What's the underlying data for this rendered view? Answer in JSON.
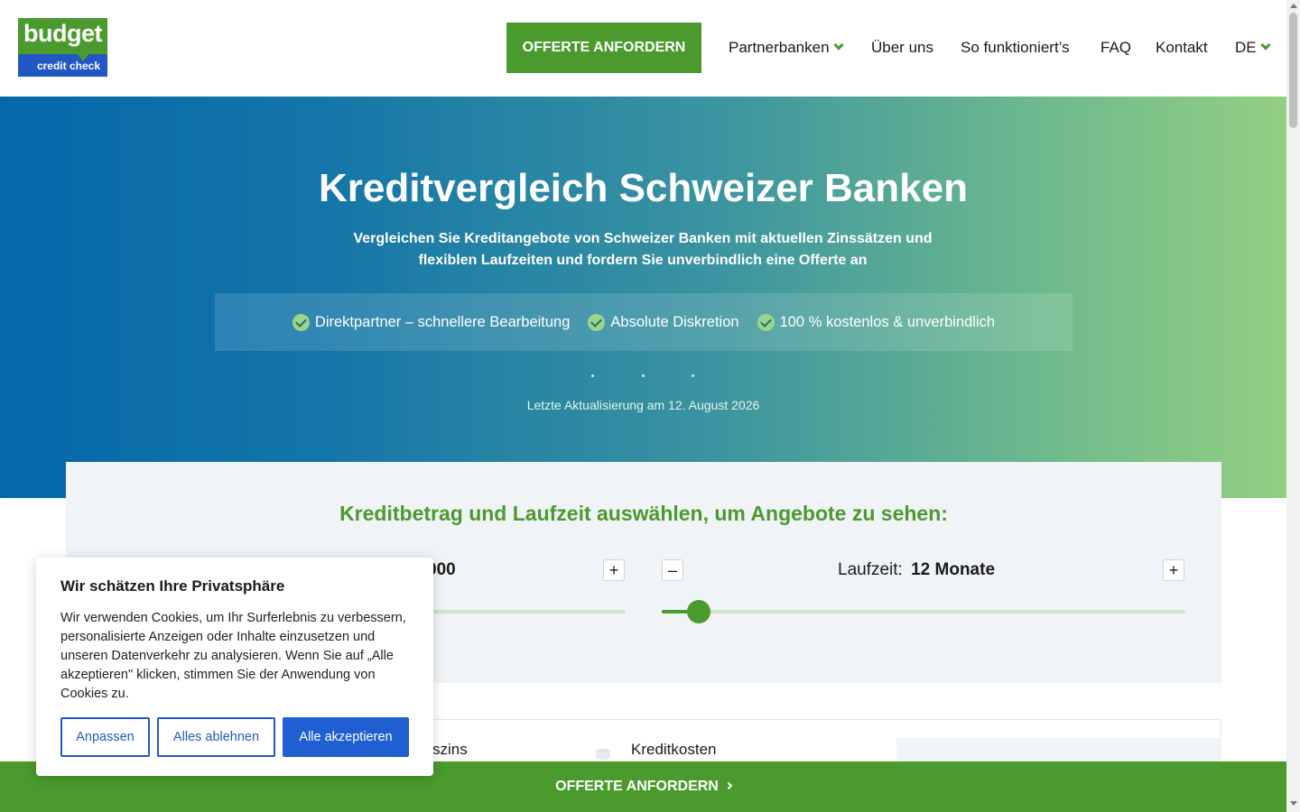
{
  "header": {
    "logo_top": "budget",
    "logo_bottom": "credit check",
    "cta_label": "OFFERTE ANFORDERN",
    "nav": {
      "partnerbanken": "Partnerbanken",
      "ueber_uns": "Über uns",
      "so_funktionierts": "So funktioniert’s",
      "faq": "FAQ",
      "kontakt": "Kontakt",
      "language": "DE"
    }
  },
  "hero": {
    "title": "Kreditvergleich Schweizer Banken",
    "subtitle": "Vergleichen Sie Kreditangebote von Schweizer Banken mit aktuellen Zinssätzen und flexiblen Laufzeiten und fordern Sie unverbindlich eine Offerte an",
    "features": [
      "Direktpartner – schnellere Bearbeitung",
      "Absolute Diskretion",
      "100 % kostenlos & unverbindlich"
    ],
    "updated": "Letzte Aktualisierung am 12. August 2026"
  },
  "calculator": {
    "title": "Kreditbetrag und Laufzeit auswählen, um Angebote zu sehen:",
    "amount_visible": "000",
    "term_label": "Laufzeit:",
    "term_value": "12 Monate",
    "term_slider_fraction": 0.07,
    "minus": "–",
    "plus": "+"
  },
  "results": {
    "col_zins_partial": "szins",
    "col_kreditkosten": "Kreditkosten"
  },
  "cookie": {
    "title": "Wir schätzen Ihre Privatsphäre",
    "text": "Wir verwenden Cookies, um Ihr Surferlebnis zu verbessern, personalisierte Anzeigen oder Inhalte einzusetzen und unseren Datenverkehr zu analysieren. Wenn Sie auf „Alle akzeptieren\" klicken, stimmen Sie der Anwendung von Cookies zu.",
    "btn_customize": "Anpassen",
    "btn_reject": "Alles ablehnen",
    "btn_accept": "Alle akzeptieren"
  },
  "sticky": {
    "cta_label": "OFFERTE ANFORDERN"
  },
  "colors": {
    "brand_green": "#4a9a2e",
    "brand_blue": "#2358c4",
    "hero_start": "#0667aa",
    "hero_end": "#93cf82"
  }
}
